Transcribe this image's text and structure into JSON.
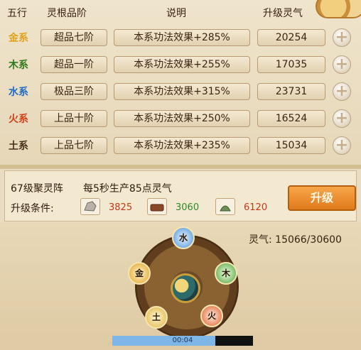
{
  "header": {
    "col_element": "五行",
    "col_grade": "灵根品阶",
    "col_desc": "说明",
    "col_upgrade": "升级灵气"
  },
  "rows": [
    {
      "element": "金系",
      "color": "#e0a21a",
      "grade": "超品七阶",
      "desc": "本系功法效果+285%",
      "value": "20254"
    },
    {
      "element": "木系",
      "color": "#2f7a1a",
      "grade": "超品一阶",
      "desc": "本系功法效果+255%",
      "value": "17035"
    },
    {
      "element": "水系",
      "color": "#1f6cc8",
      "grade": "极品三阶",
      "desc": "本系功法效果+315%",
      "value": "23731"
    },
    {
      "element": "火系",
      "color": "#d2401a",
      "grade": "上品十阶",
      "desc": "本系功法效果+250%",
      "value": "16524"
    },
    {
      "element": "土系",
      "color": "#4a2f1a",
      "grade": "上品七阶",
      "desc": "本系功法效果+235%",
      "value": "15034"
    }
  ],
  "info": {
    "title": "67级聚灵阵",
    "production": "每5秒生产85点灵气",
    "condition_label": "升级条件:",
    "resources": [
      {
        "icon": "ore-icon",
        "value": "3825",
        "color": "#c03a1a"
      },
      {
        "icon": "wood-icon",
        "value": "3060",
        "color": "#2f8a2a"
      },
      {
        "icon": "herb-icon",
        "value": "6120",
        "color": "#c03a1a"
      }
    ],
    "upgrade_label": "升级"
  },
  "lingqi": {
    "label": "灵气:",
    "value": "15066/30600"
  },
  "wheel": {
    "water": "水",
    "wood": "木",
    "fire": "火",
    "earth": "土",
    "metal": "金"
  },
  "video": {
    "time": "00:04",
    "progress": 0.73
  }
}
